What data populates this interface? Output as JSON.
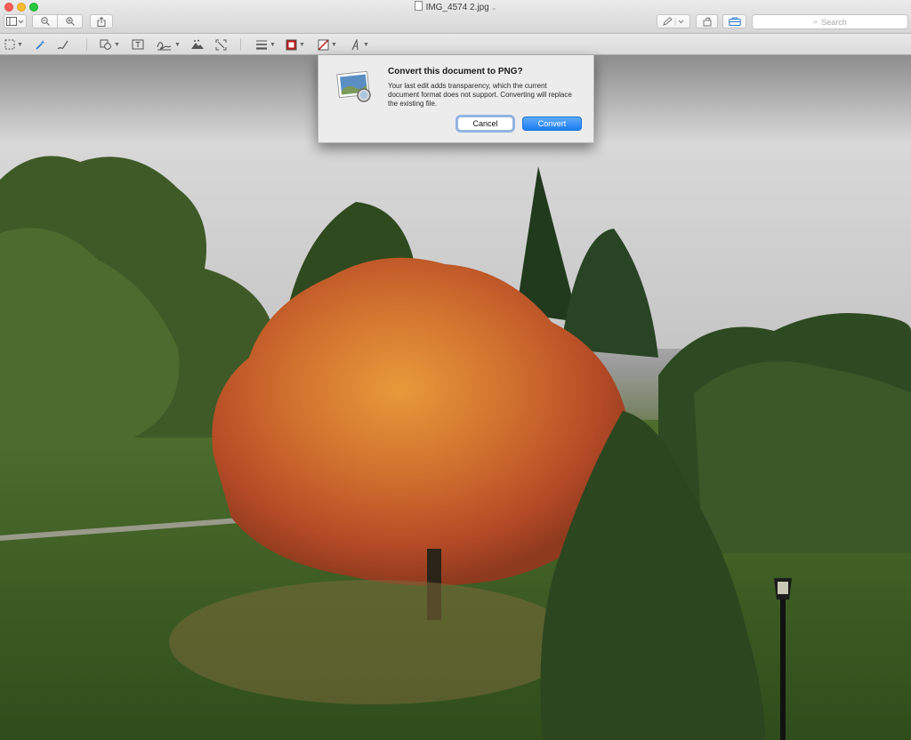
{
  "window": {
    "title": "IMG_4574 2.jpg",
    "title_chevron": "⌄"
  },
  "toolbar": {
    "sidebar_button": "sidebar-icon",
    "zoom_out": "zoom-out-icon",
    "zoom_in": "zoom-in-icon",
    "share": "share-icon",
    "markup": "pen-icon",
    "rotate": "rotate-icon",
    "toolbox": "toolbox-icon",
    "search_placeholder": "Search"
  },
  "markup_toolbar": {
    "tools": [
      "selection-icon",
      "instant-alpha-icon",
      "sketch-icon",
      "shapes-icon",
      "text-icon",
      "sign-icon",
      "adjust-color-icon",
      "adjust-size-icon",
      "line-style-icon",
      "border-color-icon",
      "fill-color-icon",
      "text-style-icon"
    ],
    "colors": {
      "border": "#c0161b",
      "fill": "#c0161b"
    }
  },
  "dialog": {
    "title": "Convert this document to PNG?",
    "message": "Your last edit adds transparency, which the current document format does not support. Converting will replace the existing file.",
    "cancel_label": "Cancel",
    "convert_label": "Convert",
    "icon": "preview-app-icon"
  },
  "colors": {
    "accent": "#1c7ef2",
    "close": "#fc5f57",
    "minimize": "#fdbc2e",
    "zoom": "#28c840"
  }
}
